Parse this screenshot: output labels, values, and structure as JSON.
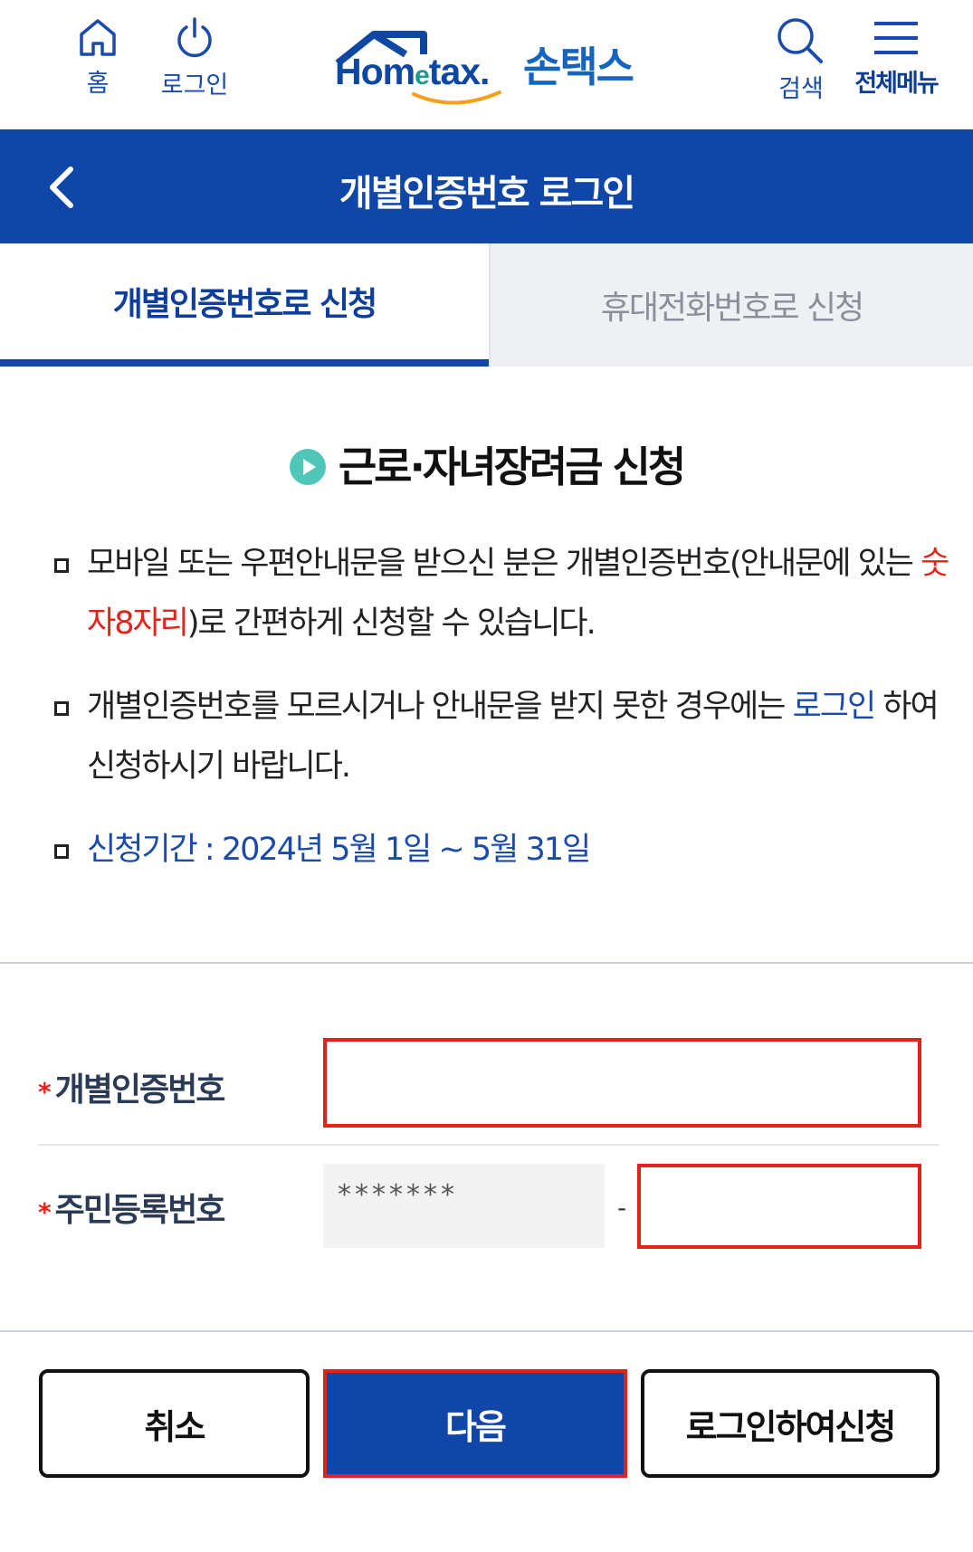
{
  "header": {
    "home_label": "홈",
    "login_label": "로그인",
    "logo_text_main": "Hom",
    "logo_text_e": "e",
    "logo_text_tail": "tax.",
    "logo_ko": "손택스",
    "search_label": "검색",
    "menu_label": "전체메뉴"
  },
  "title_bar": {
    "title": "개별인증번호 로그인"
  },
  "tabs": [
    {
      "label": "개별인증번호로 신청",
      "active": true
    },
    {
      "label": "휴대전화번호로 신청",
      "active": false
    }
  ],
  "section": {
    "title": "근로·자녀장려금 신청",
    "note1_pre": "모바일 또는 우편안내문을 받으신 분은 개별인증번호(안내문에 있는 ",
    "note1_red": "숫자8자리",
    "note1_post": ")로 간편하게 신청할 수 있습니다.",
    "note2_pre": "개별인증번호를 모르시거나 안내문을 받지 못한 경우에는 ",
    "note2_link": "로그인",
    "note2_post": " 하여 신청하시기 바랍니다.",
    "note3": "신청기간 : 2024년 5월 1일 ~ 5월 31일"
  },
  "form": {
    "auth_label": "개별인증번호",
    "rrn_label": "주민등록번호",
    "required_mark": "*",
    "rrn_front_masked": "*******",
    "rrn_dash": "-",
    "auth_value": "",
    "rrn_back_value": ""
  },
  "buttons": {
    "cancel": "취소",
    "next": "다음",
    "login_apply": "로그인하여신청"
  },
  "colors": {
    "primary": "#1046a8",
    "accent_red": "#e2231a",
    "teal": "#4fc6b8"
  }
}
